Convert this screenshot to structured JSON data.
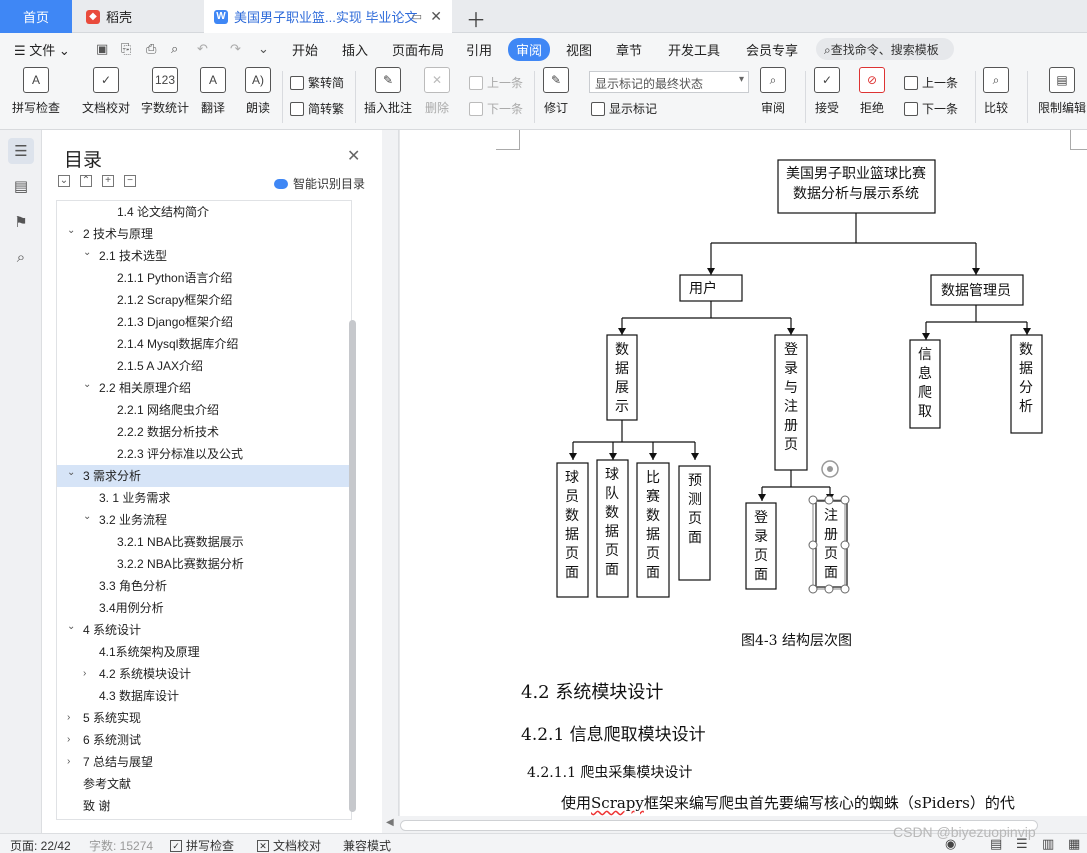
{
  "tabs": {
    "home": "首页",
    "daoke": "稻壳",
    "doc": "美国男子职业篮...实现 毕业论文"
  },
  "menu": {
    "file": "文件",
    "items": [
      "开始",
      "插入",
      "页面布局",
      "引用",
      "审阅",
      "视图",
      "章节",
      "开发工具",
      "会员专享"
    ],
    "active": "审阅",
    "search": "查找命令、搜索模板"
  },
  "ribbon": {
    "spell": "拼写检查",
    "proof": "文档校对",
    "count": "字数统计",
    "translate": "翻译",
    "read": "朗读",
    "trad": "繁转简",
    "simp": "简转繁",
    "insert_comment": "插入批注",
    "delete": "删除",
    "prev": "上一条",
    "next": "下一条",
    "revise": "修订",
    "markup_combo": "显示标记的最终状态",
    "show_markup": "显示标记",
    "review": "审阅",
    "accept": "接受",
    "reject": "拒绝",
    "prev2": "上一条",
    "next2": "下一条",
    "compare": "比较",
    "restrict": "限制编辑"
  },
  "toc": {
    "title": "目录",
    "smart": "智能识别目录",
    "items": [
      {
        "text": "1.4 论文结构简介",
        "level": 3,
        "chev": ""
      },
      {
        "text": "2 技术与原理",
        "level": 1,
        "chev": "open"
      },
      {
        "text": "2.1 技术选型",
        "level": 2,
        "chev": "open"
      },
      {
        "text": "2.1.1 Python语言介绍",
        "level": 3,
        "chev": ""
      },
      {
        "text": "2.1.2 Scrapy框架介绍",
        "level": 3,
        "chev": ""
      },
      {
        "text": "2.1.3 Django框架介绍",
        "level": 3,
        "chev": ""
      },
      {
        "text": "2.1.4 Mysql数据库介绍",
        "level": 3,
        "chev": ""
      },
      {
        "text": "2.1.5 A JAX介绍",
        "level": 3,
        "chev": ""
      },
      {
        "text": "2.2 相关原理介绍",
        "level": 2,
        "chev": "open"
      },
      {
        "text": "2.2.1 网络爬虫介绍",
        "level": 3,
        "chev": ""
      },
      {
        "text": "2.2.2 数据分析技术",
        "level": 3,
        "chev": ""
      },
      {
        "text": "2.2.3 评分标准以及公式",
        "level": 3,
        "chev": ""
      },
      {
        "text": "3 需求分析",
        "level": 1,
        "chev": "open",
        "selected": true
      },
      {
        "text": "3. 1 业务需求",
        "level": 2,
        "chev": ""
      },
      {
        "text": "3.2 业务流程",
        "level": 2,
        "chev": "open"
      },
      {
        "text": "3.2.1 NBA比赛数据展示",
        "level": 3,
        "chev": ""
      },
      {
        "text": "3.2.2 NBA比赛数据分析",
        "level": 3,
        "chev": ""
      },
      {
        "text": "3.3 角色分析",
        "level": 2,
        "chev": ""
      },
      {
        "text": "3.4用例分析",
        "level": 2,
        "chev": ""
      },
      {
        "text": "4 系统设计",
        "level": 1,
        "chev": "open"
      },
      {
        "text": "4.1系统架构及原理",
        "level": 2,
        "chev": ""
      },
      {
        "text": "4.2 系统模块设计",
        "level": 2,
        "chev": "closed"
      },
      {
        "text": "4.3  数据库设计",
        "level": 2,
        "chev": ""
      },
      {
        "text": "5 系统实现",
        "level": 1,
        "chev": "closed"
      },
      {
        "text": "6 系统测试",
        "level": 1,
        "chev": "closed"
      },
      {
        "text": "7 总结与展望",
        "level": 1,
        "chev": "closed"
      },
      {
        "text": "参考文献",
        "level": 1,
        "chev": ""
      },
      {
        "text": "致  谢",
        "level": 1,
        "chev": ""
      }
    ]
  },
  "diagram": {
    "root": [
      "美国男子职业篮球比赛",
      "数据分析与展示系统"
    ],
    "user": "用户",
    "admin": "数据管理员",
    "display": "数据展示",
    "login_reg": "登录与注册页",
    "crawl": "信息爬取",
    "analysis": "数据分析",
    "player": "球员数据页面",
    "team": "球队数据页面",
    "match": "比赛数据页面",
    "predict": "预测页面",
    "login": "登录页面",
    "register": "注册页面"
  },
  "document": {
    "caption": "图4-3  结构层次图",
    "h2": "4.2 系统模块设计",
    "h3": "4.2.1 信息爬取模块设计",
    "h4": "4.2.1.1 爬虫采集模块设计",
    "para_pre": "使用",
    "para_word": "Scrapy",
    "para_mid": "框架来编写爬虫首先要编写核心的蜘蛛（",
    "para_word2": "sPiders",
    "para_post": "）的代"
  },
  "status": {
    "page": "页面: 22/42",
    "words": "字数: 15274",
    "spell": "拼写检查",
    "proof": "文档校对",
    "compat": "兼容模式",
    "watermark": "CSDN @biyezuopinvip"
  }
}
